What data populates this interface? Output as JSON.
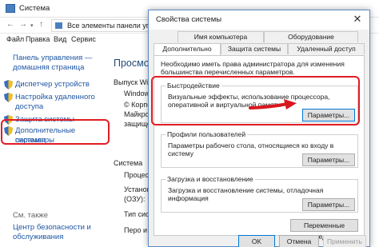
{
  "bg_window": {
    "title": "Система",
    "address": "Все элементы панели упр",
    "menu": [
      "Файл",
      "Правка",
      "Вид",
      "Сервис"
    ],
    "left_pane": {
      "home_link_line1": "Панель управления —",
      "home_link_line2": "домашняя страница",
      "links": [
        {
          "line1": "Диспетчер устройств",
          "line2": ""
        },
        {
          "line1": "Настройка удаленного",
          "line2": "доступа"
        },
        {
          "line1": "Защита системы",
          "line2": ""
        },
        {
          "line1": "Дополнительные параметры",
          "line2": "системы"
        }
      ],
      "see_also": "См. также",
      "security_line1": "Центр безопасности и",
      "security_line2": "обслуживания"
    },
    "main_pane": {
      "heading": "Просмот",
      "edition": "Выпуск Wind",
      "windows": "Windows",
      "corp": "© Корпо",
      "ms": "Майкрос",
      "reserved": "защищен",
      "system_heading": "Система",
      "processor": "Процессо",
      "ram_line1": "Установл",
      "ram_line2": "(ОЗУ):",
      "system_type": "Тип сист",
      "pen": "Перо и с"
    }
  },
  "dialog": {
    "title": "Свойства системы",
    "close_symbol": "✕",
    "tabs_row1": [
      "Имя компьютера",
      "Оборудование"
    ],
    "tabs_row2": [
      "Дополнительно",
      "Защита системы",
      "Удаленный доступ"
    ],
    "admin_note": "Необходимо иметь права администратора для изменения большинства перечисленных параметров.",
    "groups": {
      "performance": {
        "title": "Быстродействие",
        "desc": "Визуальные эффекты, использование процессора, оперативной и виртуальной памяти",
        "button": "Параметры..."
      },
      "profiles": {
        "title": "Профили пользователей",
        "desc": "Параметры рабочего стола, относящиеся ко входу в систему",
        "button": "Параметры..."
      },
      "startup": {
        "title": "Загрузка и восстановление",
        "desc": "Загрузка и восстановление системы, отладочная информация",
        "button": "Параметры..."
      }
    },
    "env_button": "Переменные среды...",
    "ok": "OK",
    "cancel": "Отмена",
    "apply": "Применить"
  },
  "colors": {
    "highlight_red": "#e21c24",
    "link_blue": "#1f57a4",
    "accent_blue": "#0078d7"
  }
}
